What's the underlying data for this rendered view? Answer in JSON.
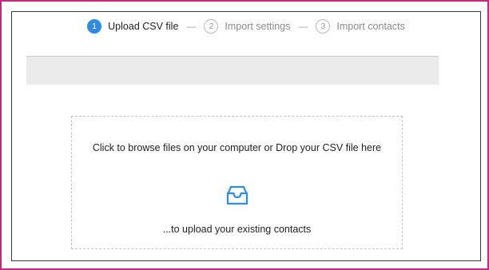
{
  "stepper": {
    "steps": [
      {
        "number": "1",
        "label": "Upload CSV file",
        "state": "active"
      },
      {
        "number": "2",
        "label": "Import settings",
        "state": "inactive"
      },
      {
        "number": "3",
        "label": "Import contacts",
        "state": "inactive"
      }
    ],
    "separator": "—"
  },
  "dropzone": {
    "title": "Click to browse files on your computer or Drop your CSV file here",
    "subtitle": "...to upload your existing contacts",
    "icon": "inbox-tray-icon"
  },
  "colors": {
    "accent": "#2d8ce6",
    "frame": "#c5287f",
    "bar": "#ebebeb"
  }
}
